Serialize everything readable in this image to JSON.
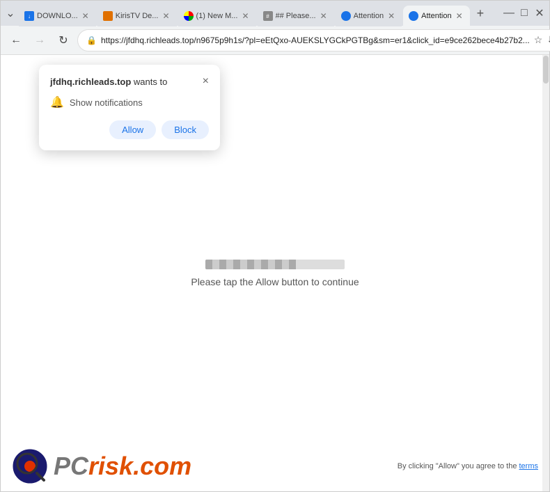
{
  "browser": {
    "tabs": [
      {
        "id": "tab1",
        "label": "DOWNLO...",
        "favicon": "download",
        "active": false,
        "closeable": true
      },
      {
        "id": "tab2",
        "label": "KirisTV De...",
        "favicon": "kiristry",
        "active": false,
        "closeable": true
      },
      {
        "id": "tab3",
        "label": "(1) New M...",
        "favicon": "new",
        "active": false,
        "closeable": true
      },
      {
        "id": "tab4",
        "label": "## Please...",
        "favicon": "hash",
        "active": false,
        "closeable": true
      },
      {
        "id": "tab5",
        "label": "Attention",
        "favicon": "attention1",
        "active": false,
        "closeable": true
      },
      {
        "id": "tab6",
        "label": "Attention",
        "favicon": "attention2",
        "active": true,
        "closeable": true
      }
    ],
    "address": "https://jfdhq.richleads.top/n9675p9h1s/?pl=eEtQxo-AUEKSLYGCkPGTBg&sm=er1&click_id=e9ce262bece4b27b2...",
    "back_enabled": true,
    "forward_enabled": false
  },
  "popup": {
    "domain": "jfdhq.richleads.top",
    "wants_to": " wants to",
    "permission_label": "Show notifications",
    "allow_label": "Allow",
    "block_label": "Block",
    "close_label": "×"
  },
  "page": {
    "instruction": "Please tap the Allow button to continue"
  },
  "footer": {
    "notice": "By clicking \"Allow\" you agree to the",
    "terms_link": "terms"
  },
  "logo": {
    "pc": "PC",
    "risk": "risk",
    "dot": ".",
    "com": "com"
  }
}
